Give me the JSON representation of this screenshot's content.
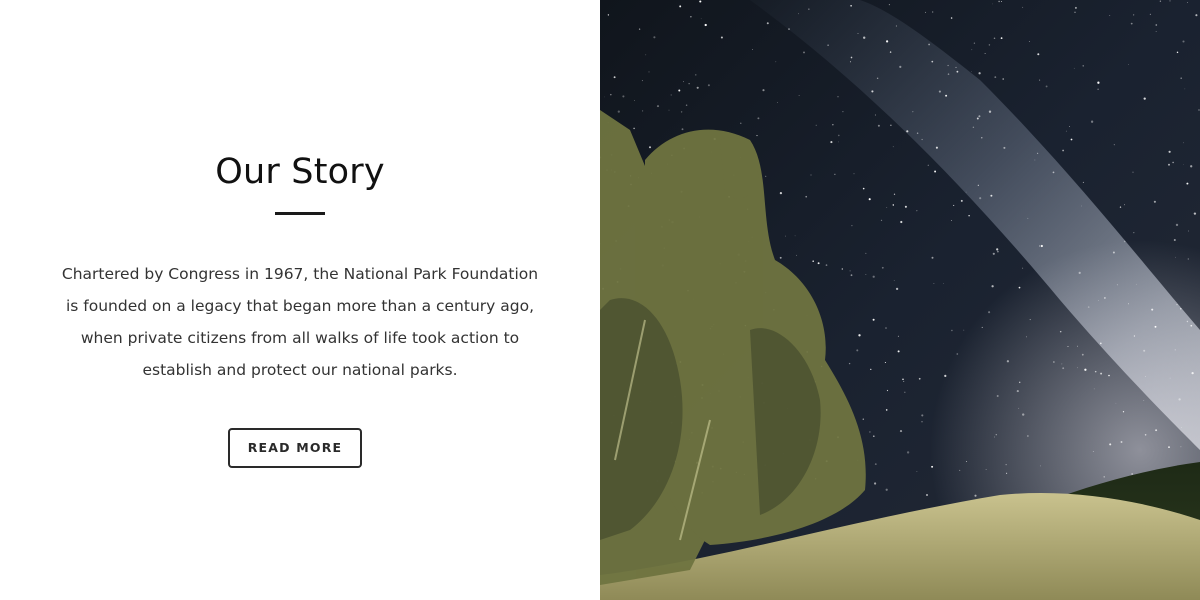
{
  "section": {
    "title": "Our Story",
    "body_lines": [
      "Chartered by Congress in 1967, the National Park Foundation",
      "is founded on a legacy that began more than a century ago,",
      "when private citizens from all walks of life took action to",
      "establish and protect our national parks."
    ],
    "button_label": "READ MORE"
  },
  "colors": {
    "text_dark": "#111111",
    "body_text": "#333333",
    "button_border": "#2a2a2a",
    "sky": "#0d1117",
    "grass": "#b9b27a",
    "trees": "#6f7440"
  },
  "image": {
    "subject": "night-sky-milky-way-over-trees-and-meadow"
  }
}
